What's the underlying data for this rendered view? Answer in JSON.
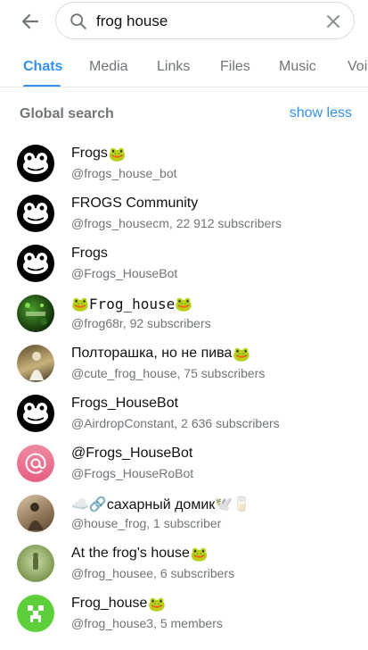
{
  "search": {
    "value": "frog house"
  },
  "tabs": [
    {
      "label": "Chats",
      "active": true
    },
    {
      "label": "Media"
    },
    {
      "label": "Links"
    },
    {
      "label": "Files"
    },
    {
      "label": "Music"
    },
    {
      "label": "Voi"
    }
  ],
  "section": {
    "title": "Global search",
    "action": "show less"
  },
  "results": [
    {
      "title": "Frogs",
      "emoji": "🐸",
      "subtitle": "@frogs_house_bot",
      "avatar": "frog-logo-black"
    },
    {
      "title": "FROGS Community",
      "emoji": "",
      "subtitle": "@frogs_housecm, 22 912 subscribers",
      "avatar": "frog-logo-black"
    },
    {
      "title": "Frogs",
      "emoji": "",
      "subtitle": "@Frogs_HouseBot",
      "avatar": "frog-logo-black"
    },
    {
      "title": "🐸Frog_house🐸",
      "emoji": "",
      "subtitle": "@frog68r, 92 subscribers",
      "avatar": "green-photo"
    },
    {
      "title": "Полторашка, но не пива",
      "emoji": "🐸",
      "subtitle": "@cute_frog_house, 75 subscribers",
      "avatar": "person-photo"
    },
    {
      "title": "Frogs_HouseBot",
      "emoji": "",
      "subtitle": "@AirdropConstant, 2 636 subscribers",
      "avatar": "frog-logo-black"
    },
    {
      "title": "@Frogs_HouseBot",
      "emoji": "",
      "subtitle": "@Frogs_HouseRoBot",
      "avatar": "pink-at"
    },
    {
      "title": "☁️🔗сахарный домик🕊️🥛",
      "emoji": "",
      "subtitle": "@house_frog, 1 subscriber",
      "avatar": "sepia-photo"
    },
    {
      "title": "At the frog's house",
      "emoji": "🐸",
      "subtitle": "@frog_housee, 6 subscribers",
      "avatar": "frog-field-photo"
    },
    {
      "title": "Frog_house",
      "emoji": "🐸",
      "subtitle": "@frog_house3, 5 members",
      "avatar": "creeper-green"
    }
  ],
  "colors": {
    "accent": "#3390ec",
    "muted": "#707579",
    "pink": "#e96b8a",
    "creeper": "#5ccf3a"
  }
}
